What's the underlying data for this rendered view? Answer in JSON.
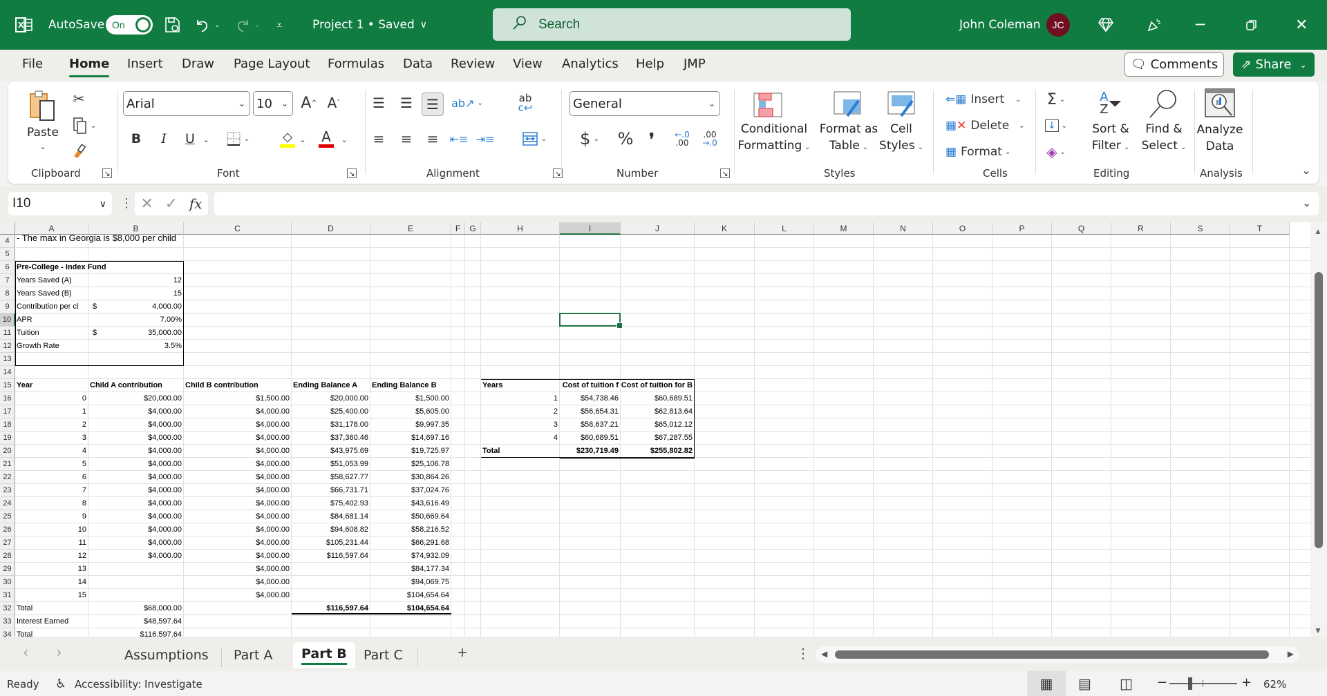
{
  "titlebar": {
    "autosave_label": "AutoSave",
    "autosave_state": "On",
    "document_title": "Project 1 • Saved",
    "search_placeholder": "Search",
    "user_name": "John Coleman",
    "user_initials": "JC"
  },
  "menu": {
    "tabs": [
      "File",
      "Home",
      "Insert",
      "Draw",
      "Page Layout",
      "Formulas",
      "Data",
      "Review",
      "View",
      "Analytics",
      "Help",
      "JMP"
    ],
    "active": "Home",
    "comments_label": "Comments",
    "share_label": "Share"
  },
  "ribbon": {
    "clipboard": {
      "paste_label": "Paste",
      "group_label": "Clipboard"
    },
    "font": {
      "font_name": "Arial",
      "font_size": "10",
      "group_label": "Font",
      "bold": "B",
      "italic": "I",
      "underline": "U",
      "highlight_color": "#ffff00",
      "font_color": "#e00000"
    },
    "alignment": {
      "group_label": "Alignment"
    },
    "number": {
      "format": "General",
      "currency": "$",
      "percent": "%",
      "comma": "9",
      "group_label": "Number"
    },
    "styles": {
      "conditional_formatting": [
        "Conditional",
        "Formatting"
      ],
      "format_as_table": [
        "Format as",
        "Table"
      ],
      "cell_styles": [
        "Cell",
        "Styles"
      ],
      "group_label": "Styles"
    },
    "cells": {
      "insert": "Insert",
      "delete": "Delete",
      "format": "Format",
      "group_label": "Cells"
    },
    "editing": {
      "sort_filter": [
        "Sort &",
        "Filter"
      ],
      "find_select": [
        "Find &",
        "Select"
      ],
      "group_label": "Editing"
    },
    "analysis": {
      "analyze_data": [
        "Analyze",
        "Data"
      ],
      "group_label": "Analysis"
    }
  },
  "formula_bar": {
    "name_box": "I10",
    "formula": ""
  },
  "grid": {
    "columns": [
      "A",
      "B",
      "C",
      "D",
      "E",
      "F",
      "G",
      "H",
      "I",
      "J",
      "K",
      "L",
      "M",
      "N",
      "O",
      "P",
      "Q",
      "R",
      "S",
      "T"
    ],
    "selected_column": "I",
    "rows": [
      "4",
      "5",
      "6",
      "7",
      "8",
      "9",
      "10",
      "11",
      "12",
      "13",
      "14",
      "15",
      "16",
      "17",
      "18",
      "19",
      "20",
      "21",
      "22",
      "23",
      "24",
      "25",
      "26",
      "27",
      "28",
      "29",
      "30",
      "31",
      "32",
      "33",
      "34"
    ],
    "selected_row": "10",
    "note_row4": "- The max in Georgia is $8,000 per child",
    "assumptions": {
      "title": "Pre-College - Index Fund",
      "items": [
        {
          "label": "Years Saved (A)",
          "sym": "",
          "value": "12"
        },
        {
          "label": "Years Saved (B)",
          "sym": "",
          "value": "15"
        },
        {
          "label": "Contribution per cl",
          "sym": "$",
          "value": "4,000.00"
        },
        {
          "label": "APR",
          "sym": "",
          "value": "7.00%"
        },
        {
          "label": "Tuition",
          "sym": "$",
          "value": "35,000.00"
        },
        {
          "label": "Growth Rate",
          "sym": "",
          "value": "3.5%"
        }
      ]
    },
    "savings_table": {
      "headers": [
        "Year",
        "Child A contribution",
        "Child B  contribution",
        "Ending Balance A",
        "Ending Balance B"
      ],
      "rows": [
        [
          "0",
          "$20,000.00",
          "$1,500.00",
          "$20,000.00",
          "$1,500.00"
        ],
        [
          "1",
          "$4,000.00",
          "$4,000.00",
          "$25,400.00",
          "$5,605.00"
        ],
        [
          "2",
          "$4,000.00",
          "$4,000.00",
          "$31,178.00",
          "$9,997.35"
        ],
        [
          "3",
          "$4,000.00",
          "$4,000.00",
          "$37,360.46",
          "$14,697.16"
        ],
        [
          "4",
          "$4,000.00",
          "$4,000.00",
          "$43,975.69",
          "$19,725.97"
        ],
        [
          "5",
          "$4,000.00",
          "$4,000.00",
          "$51,053.99",
          "$25,106.78"
        ],
        [
          "6",
          "$4,000.00",
          "$4,000.00",
          "$58,627.77",
          "$30,864.26"
        ],
        [
          "7",
          "$4,000.00",
          "$4,000.00",
          "$66,731.71",
          "$37,024.76"
        ],
        [
          "8",
          "$4,000.00",
          "$4,000.00",
          "$75,402.93",
          "$43,616.49"
        ],
        [
          "9",
          "$4,000.00",
          "$4,000.00",
          "$84,681.14",
          "$50,669.64"
        ],
        [
          "10",
          "$4,000.00",
          "$4,000.00",
          "$94,608.82",
          "$58,216.52"
        ],
        [
          "11",
          "$4,000.00",
          "$4,000.00",
          "$105,231.44",
          "$66,291.68"
        ],
        [
          "12",
          "$4,000.00",
          "$4,000.00",
          "$116,597.64",
          "$74,932.09"
        ],
        [
          "13",
          "",
          "$4,000.00",
          "",
          "$84,177.34"
        ],
        [
          "14",
          "",
          "$4,000.00",
          "",
          "$94,069.75"
        ],
        [
          "15",
          "",
          "$4,000.00",
          "",
          "$104,654.64"
        ]
      ],
      "total_row": [
        "Total",
        "$68,000.00",
        "",
        "$116,597.64",
        "$104,654.64"
      ],
      "interest_row": [
        "Interest Earned",
        "$48,597.64"
      ],
      "grand_total_row": [
        "Total",
        "$116,597.64"
      ]
    },
    "tuition_table": {
      "headers": [
        "Years",
        "Cost of tuition f",
        "Cost of tuition for B"
      ],
      "rows": [
        [
          "1",
          "$54,738.46",
          "$60,689.51"
        ],
        [
          "2",
          "$56,654.31",
          "$62,813.64"
        ],
        [
          "3",
          "$58,637.21",
          "$65,012.12"
        ],
        [
          "4",
          "$60,689.51",
          "$67,287.55"
        ]
      ],
      "total_row": [
        "Total",
        "$230,719.49",
        "$255,802.82"
      ]
    }
  },
  "sheets": {
    "tabs": [
      "Assumptions",
      "Part A",
      "Part B",
      "Part C"
    ],
    "active": "Part B",
    "add_label": "+"
  },
  "status": {
    "ready": "Ready",
    "accessibility": "Accessibility: Investigate",
    "zoom": "62%",
    "zoom_level_percent": 62
  }
}
